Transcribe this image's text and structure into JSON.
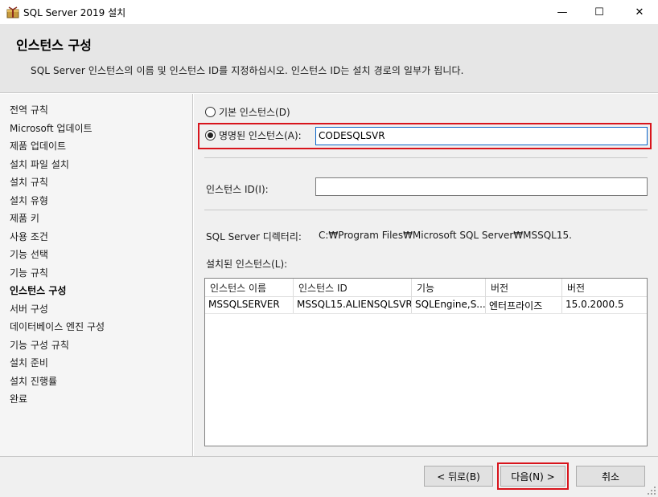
{
  "window": {
    "title": "SQL Server 2019 설치",
    "minimize_glyph": "—",
    "maximize_glyph": "☐",
    "close_glyph": "✕"
  },
  "header": {
    "title": "인스턴스 구성",
    "description": "SQL Server 인스턴스의 이름 및 인스턴스 ID를 지정하십시오. 인스턴스 ID는 설치 경로의 일부가 됩니다."
  },
  "sidebar": {
    "items": [
      {
        "label": "전역 규칙"
      },
      {
        "label": "Microsoft 업데이트"
      },
      {
        "label": "제품 업데이트"
      },
      {
        "label": "설치 파일 설치"
      },
      {
        "label": "설치 규칙"
      },
      {
        "label": "설치 유형"
      },
      {
        "label": "제품 키"
      },
      {
        "label": "사용 조건"
      },
      {
        "label": "기능 선택"
      },
      {
        "label": "기능 규칙"
      },
      {
        "label": "인스턴스 구성"
      },
      {
        "label": "서버 구성"
      },
      {
        "label": "데이터베이스 엔진 구성"
      },
      {
        "label": "기능 구성 규칙"
      },
      {
        "label": "설치 준비"
      },
      {
        "label": "설치 진행률"
      },
      {
        "label": "완료"
      }
    ],
    "active_item": "인스턴스 구성"
  },
  "form": {
    "default_instance_label": "기본 인스턴스(D)",
    "default_instance_selected": false,
    "named_instance_label": "명명된 인스턴스(A):",
    "named_instance_selected": true,
    "named_instance_value": "CODESQLSVR",
    "instance_id_label": "인스턴스 ID(I):",
    "instance_id_value": "",
    "directory_label": "SQL Server 디렉터리:",
    "directory_value": "C:₩Program Files₩Microsoft SQL Server₩MSSQL15.",
    "installed_instances_label": "설치된 인스턴스(L):"
  },
  "table": {
    "columns": [
      "인스턴스 이름",
      "인스턴스 ID",
      "기능",
      "버전",
      "버전"
    ],
    "rows": [
      [
        "MSSQLSERVER",
        "MSSQL15.ALIENSQLSVR",
        "SQLEngine,S...",
        "엔터프라이즈",
        "15.0.2000.5"
      ]
    ]
  },
  "footer": {
    "back_label": "< 뒤로(B)",
    "next_label": "다음(N) >",
    "cancel_label": "취소"
  },
  "colors": {
    "highlight": "#d8141c",
    "focus_border": "#0a64c8",
    "header_bg": "#e6e6e6",
    "sidebar_bg": "#f5f5f5",
    "panel_bg": "#f0f0f0"
  },
  "icons": {
    "app": "sql-server-installer-icon",
    "grip": "resize-grip-icon"
  }
}
